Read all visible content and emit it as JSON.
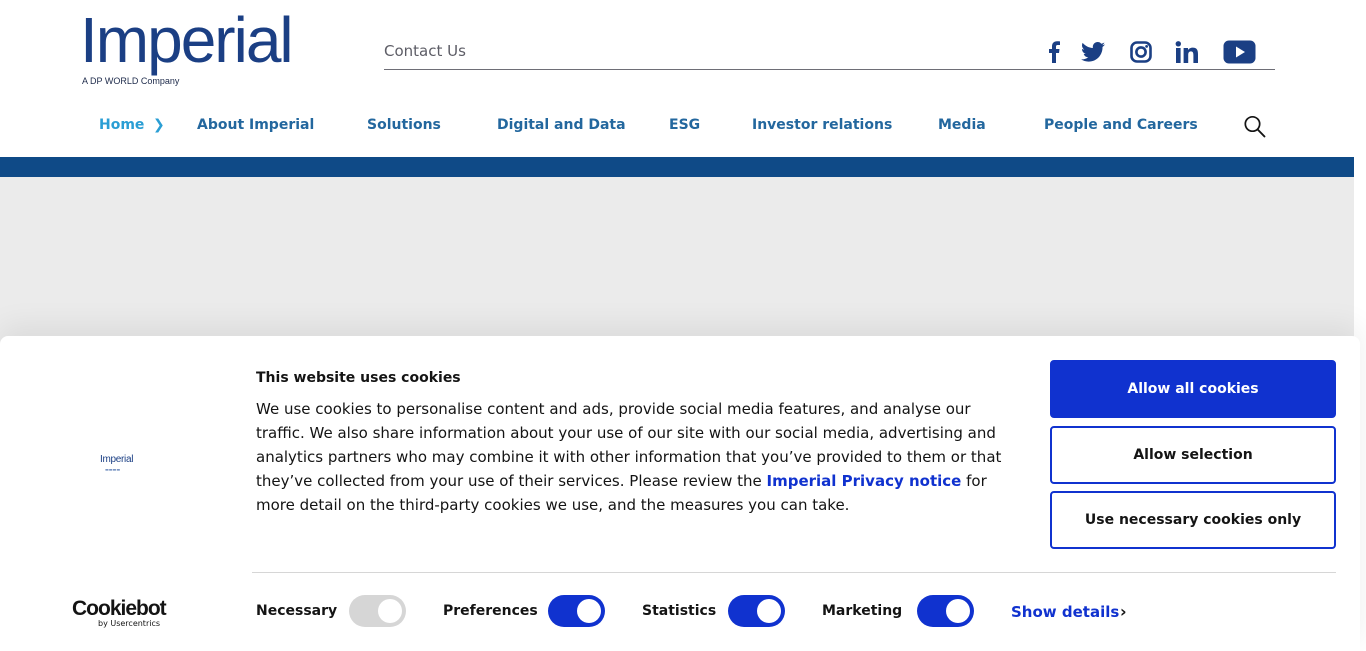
{
  "header": {
    "logo_text": "Imperial",
    "logo_tagline": "A DP WORLD Company",
    "contact_label": "Contact Us",
    "social": [
      "facebook-icon",
      "twitter-icon",
      "instagram-icon",
      "linkedin-icon",
      "youtube-icon"
    ]
  },
  "nav": {
    "items": [
      {
        "label": "Home",
        "active": true
      },
      {
        "label": "About Imperial"
      },
      {
        "label": "Solutions"
      },
      {
        "label": "Digital and Data"
      },
      {
        "label": "ESG"
      },
      {
        "label": "Investor relations"
      },
      {
        "label": "Media"
      },
      {
        "label": "People and Careers"
      }
    ],
    "active_chevron": "❯",
    "search_icon": "search-icon"
  },
  "cookie_banner": {
    "brand_logo_text": "Imperial",
    "title": "This website uses cookies",
    "body_before_link": "We use cookies to personalise content and ads, provide social media features, and analyse our traffic. We also share information about your use of our site with our social media, advertising and analytics partners who may combine it with other information that you’ve provided to them or that they’ve collected from your use of their services. Please review the ",
    "link_text": "Imperial Privacy notice",
    "body_after_link": " for more detail on the third-party cookies we use, and the measures you can take.",
    "buttons": {
      "allow_all": "Allow all cookies",
      "allow_selection": "Allow selection",
      "necessary_only": "Use necessary cookies only"
    },
    "toggles": [
      {
        "label": "Necessary",
        "on": true,
        "disabled": true
      },
      {
        "label": "Preferences",
        "on": true
      },
      {
        "label": "Statistics",
        "on": true
      },
      {
        "label": "Marketing",
        "on": true
      }
    ],
    "show_details": "Show details",
    "show_details_chevron": "›",
    "cookiebot_wordmark": "Cookiebot",
    "cookiebot_by": "by Usercentrics"
  },
  "colors": {
    "brand_navy": "#1b3f84",
    "nav_blue": "#23679e",
    "active_blue": "#2a9ed4",
    "band_blue": "#0f4a87",
    "cookie_blue": "#1032cf"
  }
}
